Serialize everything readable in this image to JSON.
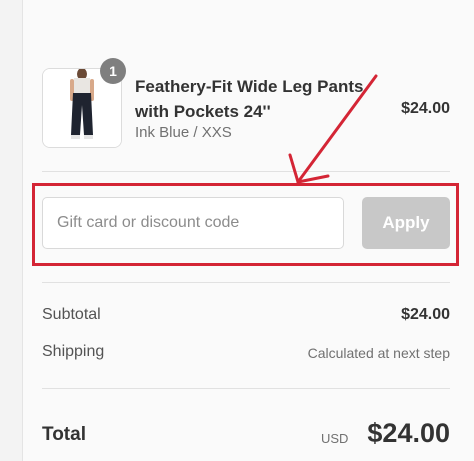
{
  "cart": {
    "item": {
      "quantity": "1",
      "name": "Feathery-Fit Wide Leg Pants with Pockets 24''",
      "variant": "Ink Blue / XXS",
      "price": "$24.00",
      "image_icon": "pants-product-image"
    }
  },
  "discount": {
    "placeholder": "Gift card or discount code",
    "value": "",
    "apply_label": "Apply"
  },
  "summary": {
    "subtotal_label": "Subtotal",
    "subtotal_value": "$24.00",
    "shipping_label": "Shipping",
    "shipping_value": "Calculated at next step",
    "total_label": "Total",
    "currency": "USD",
    "total_value": "$24.00"
  },
  "colors": {
    "annotation_red": "#d42535",
    "apply_disabled": "#c8c8c8",
    "badge": "#7f7f7f"
  }
}
